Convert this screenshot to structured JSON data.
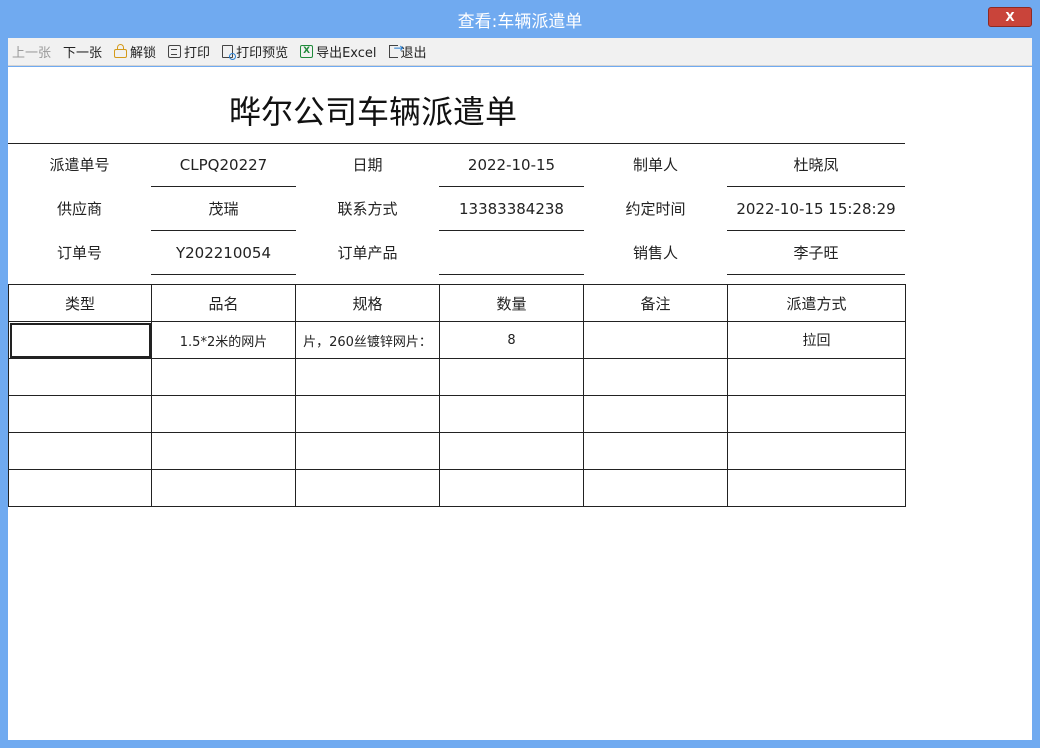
{
  "window": {
    "title": "查看:车辆派遣单",
    "close_label": "X"
  },
  "toolbar": {
    "prev": "上一张",
    "next": "下一张",
    "unlock": "解锁",
    "print": "打印",
    "print_preview": "打印预览",
    "export_excel": "导出Excel",
    "exit": "退出",
    "icons": [
      "lock-icon",
      "printer-icon",
      "print-preview-icon",
      "excel-icon",
      "exit-icon"
    ]
  },
  "document": {
    "title": "晔尔公司车辆派遣单",
    "fields": {
      "dispatch_no_label": "派遣单号",
      "dispatch_no": "CLPQ20227",
      "date_label": "日期",
      "date": "2022-10-15",
      "creator_label": "制单人",
      "creator": "杜晓凤",
      "supplier_label": "供应商",
      "supplier": "茂瑞",
      "contact_label": "联系方式",
      "contact": "13383384238",
      "appointed_time_label": "约定时间",
      "appointed_time": "2022-10-15 15:28:29",
      "order_no_label": "订单号",
      "order_no": "Y202210054",
      "order_product_label": "订单产品",
      "order_product": "",
      "salesperson_label": "销售人",
      "salesperson": "李子旺"
    },
    "table": {
      "headers": [
        "类型",
        "品名",
        "规格",
        "数量",
        "备注",
        "派遣方式"
      ],
      "rows": [
        [
          "",
          "1.5*2米的网片",
          "片，260丝镀锌网片：",
          "8",
          "",
          "拉回"
        ],
        [
          "",
          "",
          "",
          "",
          "",
          ""
        ],
        [
          "",
          "",
          "",
          "",
          "",
          ""
        ],
        [
          "",
          "",
          "",
          "",
          "",
          ""
        ],
        [
          "",
          "",
          "",
          "",
          "",
          ""
        ]
      ]
    }
  }
}
